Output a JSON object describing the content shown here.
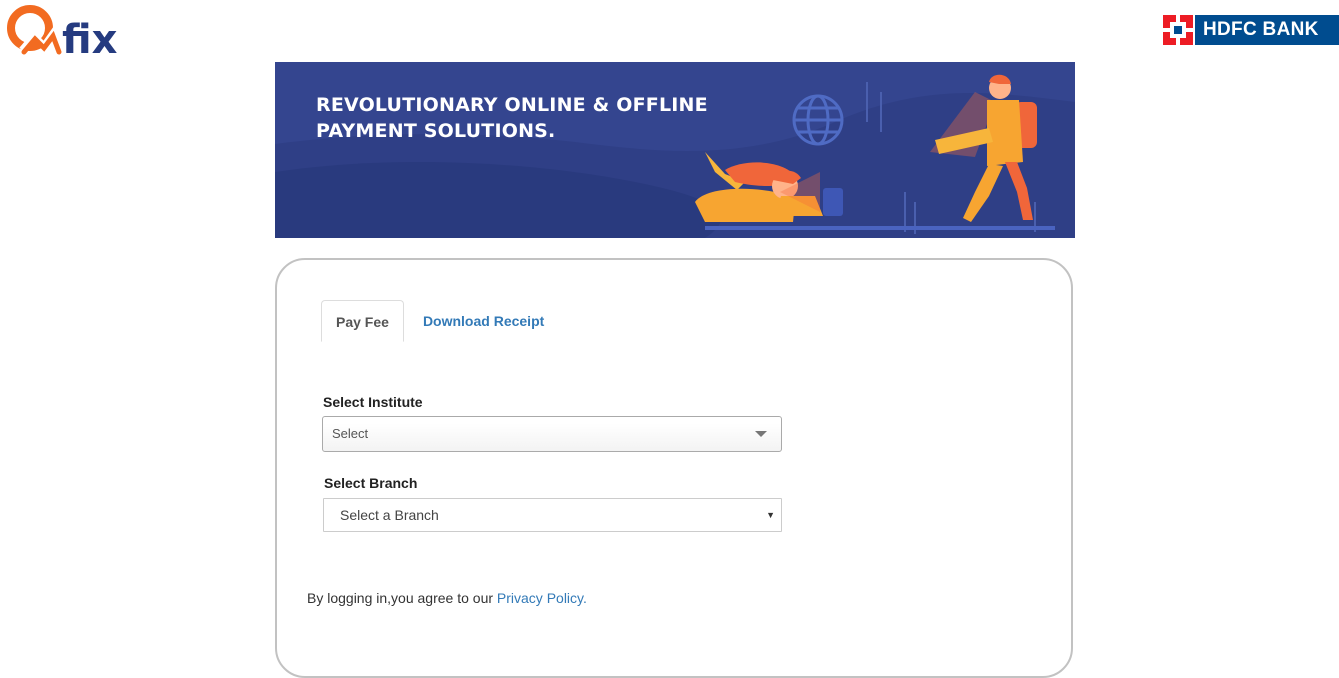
{
  "header": {
    "qfix_logo_text": "Qfix",
    "bank_logo_text": "HDFC BANK"
  },
  "banner": {
    "line1": "REVOLUTIONARY ONLINE & OFFLINE",
    "line2": "PAYMENT SOLUTIONS."
  },
  "tabs": [
    {
      "label": "Pay Fee",
      "active": true
    },
    {
      "label": "Download Receipt",
      "active": false
    }
  ],
  "form": {
    "institute_label": "Select Institute",
    "institute_value": "Select",
    "branch_label": "Select Branch",
    "branch_value": "Select a Branch"
  },
  "footer": {
    "agree_text": "By logging in,you agree to our ",
    "privacy_link": "Privacy Policy."
  },
  "colors": {
    "qfix_orange": "#f26b21",
    "qfix_navy": "#253b80",
    "banner_bg": "#2f3f86",
    "hdfc_blue": "#004c8f",
    "hdfc_red": "#ed1c24",
    "link": "#337ab7"
  }
}
